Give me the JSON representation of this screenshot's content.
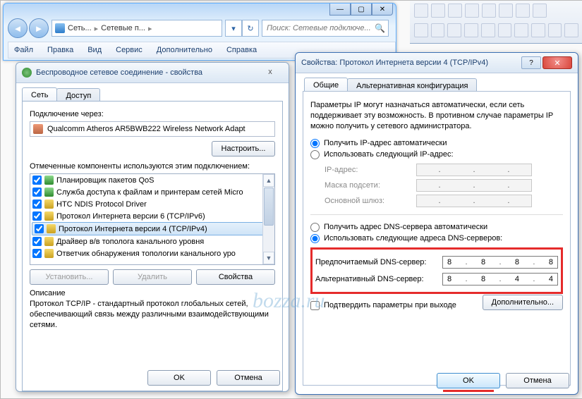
{
  "bg": {
    "search_placeholder": "Поиск: Сетевые подключе..."
  },
  "breadcrumb": {
    "part1": "Сеть...",
    "part2": "Сетевые п..."
  },
  "menubar": [
    "Файл",
    "Правка",
    "Вид",
    "Сервис",
    "Дополнительно",
    "Справка"
  ],
  "dlg1": {
    "title": "Беспроводное сетевое соединение - свойства",
    "tabs": [
      "Сеть",
      "Доступ"
    ],
    "connect_label": "Подключение через:",
    "adapter": "Qualcomm Atheros AR5BWB222 Wireless Network Adapt",
    "configure": "Настроить...",
    "components_label": "Отмеченные компоненты используются этим подключением:",
    "components": [
      "Планировщик пакетов QoS",
      "Служба доступа к файлам и принтерам сетей Micro",
      "HTC NDIS Protocol Driver",
      "Протокол Интернета версии 6 (TCP/IPv6)",
      "Протокол Интернета версии 4 (TCP/IPv4)",
      "Драйвер в/в тополога канального уровня",
      "Ответчик обнаружения топологии канального уро"
    ],
    "install": "Установить...",
    "remove": "Удалить",
    "props": "Свойства",
    "desc_label": "Описание",
    "desc_text": "Протокол TCP/IP - стандартный протокол глобальных сетей, обеспечивающий связь между различными взаимодействующими сетями.",
    "ok": "OK",
    "cancel": "Отмена"
  },
  "dlg2": {
    "title": "Свойства: Протокол Интернета версии 4 (TCP/IPv4)",
    "tabs": [
      "Общие",
      "Альтернативная конфигурация"
    ],
    "intro": "Параметры IP могут назначаться автоматически, если сеть поддерживает эту возможность. В противном случае параметры IP можно получить у сетевого администратора.",
    "r_ip_auto": "Получить IP-адрес автоматически",
    "r_ip_man": "Использовать следующий IP-адрес:",
    "ip_label": "IP-адрес:",
    "mask_label": "Маска подсети:",
    "gw_label": "Основной шлюз:",
    "r_dns_auto": "Получить адрес DNS-сервера автоматически",
    "r_dns_man": "Использовать следующие адреса DNS-серверов:",
    "dns1_label": "Предпочитаемый DNS-сервер:",
    "dns2_label": "Альтернативный DNS-сервер:",
    "dns1": [
      "8",
      "8",
      "8",
      "8"
    ],
    "dns2": [
      "8",
      "8",
      "4",
      "4"
    ],
    "confirm": "Подтвердить параметры при выходе",
    "advanced": "Дополнительно...",
    "ok": "OK",
    "cancel": "Отмена"
  },
  "watermark": "bozza.ru"
}
